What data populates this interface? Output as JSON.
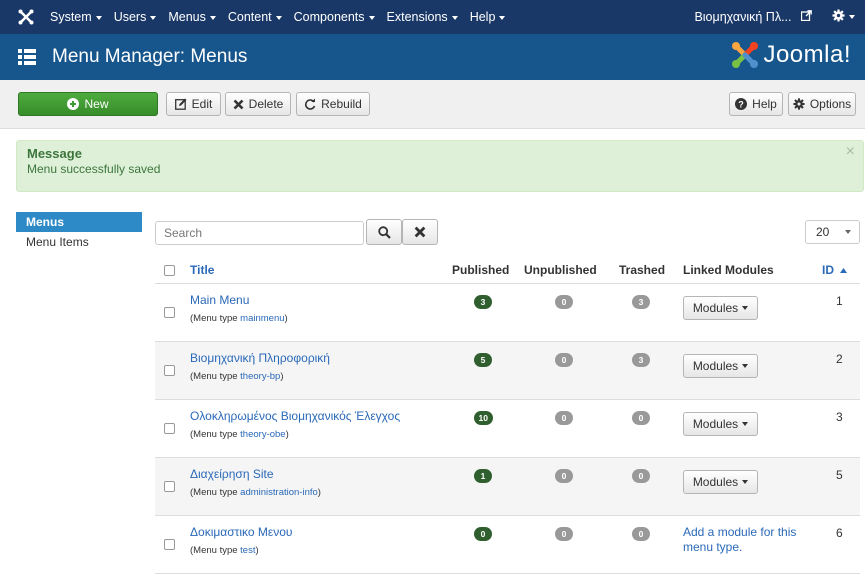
{
  "topbar": {
    "menus": [
      "System",
      "Users",
      "Menus",
      "Content",
      "Components",
      "Extensions",
      "Help"
    ],
    "site_name": "Βιομηχανική Πλ..."
  },
  "header": {
    "title": "Menu Manager: Menus",
    "brand": "Joomla!"
  },
  "toolbar": {
    "new_label": "New",
    "edit_label": "Edit",
    "delete_label": "Delete",
    "rebuild_label": "Rebuild",
    "help_label": "Help",
    "options_label": "Options"
  },
  "message": {
    "heading": "Message",
    "text": "Menu successfully saved"
  },
  "sidebar": {
    "items": [
      {
        "label": "Menus",
        "active": true
      },
      {
        "label": "Menu Items",
        "active": false
      }
    ]
  },
  "search": {
    "placeholder": "Search"
  },
  "list_limit": "20",
  "table": {
    "headers": {
      "title": "Title",
      "published": "Published",
      "unpublished": "Unpublished",
      "trashed": "Trashed",
      "linked_modules": "Linked Modules",
      "id": "ID"
    },
    "menu_type_prefix": "(Menu type",
    "menu_type_suffix": ")",
    "modules_label": "Modules",
    "add_module_text": "Add a module for this menu type.",
    "rows": [
      {
        "title": "Main Menu",
        "menu_type": "mainmenu",
        "published": "3",
        "unpublished": "0",
        "trashed": "3",
        "has_modules": true,
        "id": "1"
      },
      {
        "title": "Βιομηχανική Πληροφορική",
        "menu_type": "theory-bp",
        "published": "5",
        "unpublished": "0",
        "trashed": "3",
        "has_modules": true,
        "id": "2"
      },
      {
        "title": "Ολοκληρωμένος Βιομηχανικός Έλεγχος",
        "menu_type": "theory-obe",
        "published": "10",
        "unpublished": "0",
        "trashed": "0",
        "has_modules": true,
        "id": "3"
      },
      {
        "title": "Διαχείρηση Site",
        "menu_type": "administration-info",
        "published": "1",
        "unpublished": "0",
        "trashed": "0",
        "has_modules": true,
        "id": "5"
      },
      {
        "title": "Δοκιμαστικο Μενου",
        "menu_type": "test",
        "published": "0",
        "unpublished": "0",
        "trashed": "0",
        "has_modules": false,
        "id": "6"
      }
    ]
  },
  "colors": {
    "topbar_bg": "#1a3867",
    "header_bg": "#17568c",
    "new_button": "#3f9c35",
    "link": "#2a69b8",
    "published_badge": "#2f5f2f",
    "alert_bg": "#dff0d8"
  },
  "icons": {
    "joomla_logo": "joomla-logo-icon",
    "menu_list": "list-icon",
    "new": "plus-circle-icon",
    "edit": "edit-icon",
    "delete": "close-icon",
    "rebuild": "refresh-icon",
    "help": "question-circle-icon",
    "options": "gear-icon",
    "search": "search-icon",
    "clear": "close-icon",
    "external": "external-link-icon"
  }
}
